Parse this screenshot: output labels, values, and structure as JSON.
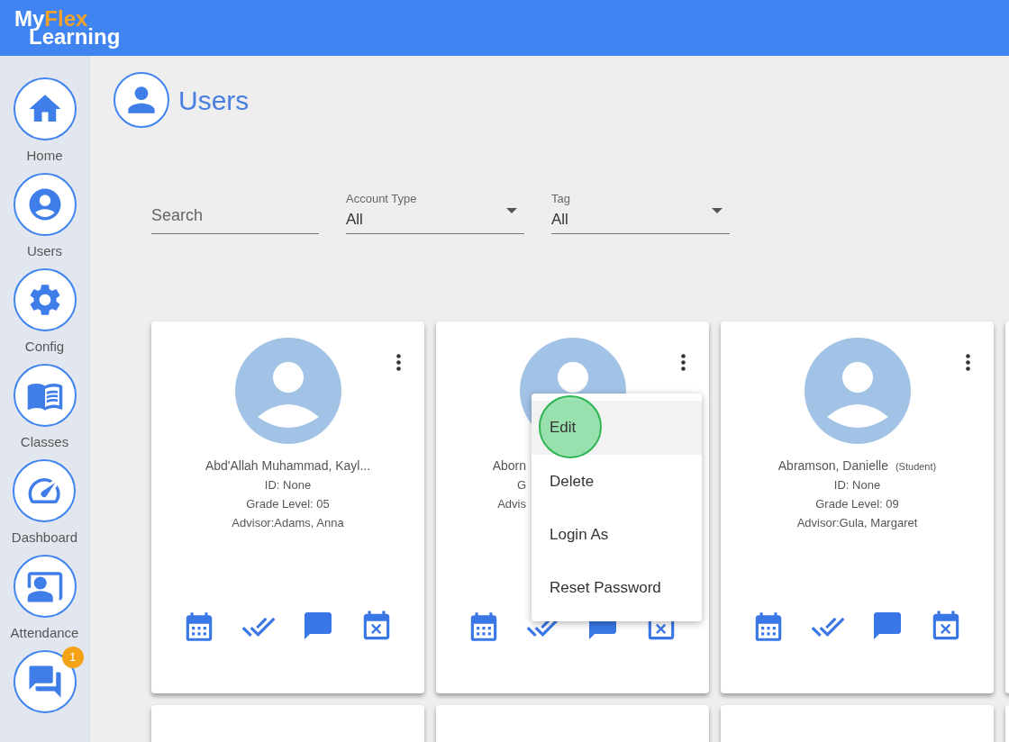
{
  "logo": {
    "top_plain": "My",
    "top_accent": "Flex",
    "bottom": "Learning"
  },
  "sidebar": {
    "items": [
      {
        "kind": "home",
        "label": "Home"
      },
      {
        "kind": "users",
        "label": "Users"
      },
      {
        "kind": "config",
        "label": "Config"
      },
      {
        "kind": "classes",
        "label": "Classes"
      },
      {
        "kind": "dashboard",
        "label": "Dashboard"
      },
      {
        "kind": "attendance",
        "label": "Attendance"
      },
      {
        "kind": "messages",
        "badge": "1"
      }
    ]
  },
  "page_title": "Users",
  "filters": {
    "search": {
      "placeholder": "Search"
    },
    "selects": [
      {
        "label": "Account Type",
        "value": "All"
      },
      {
        "label": "Tag",
        "value": "All"
      }
    ]
  },
  "cards": [
    {
      "name": "Abd'Allah Muhammad, Kayl...",
      "lines": [
        "ID: None",
        "Grade Level: 05",
        "Advisor:Adams, Anna"
      ],
      "menu_open": false
    },
    {
      "name": "Aborn",
      "lines": [
        "G",
        "Advis"
      ],
      "menu_open": true
    },
    {
      "name": "Abramson, Danielle",
      "role": "(Student)",
      "lines": [
        "ID: None",
        "Grade Level: 09",
        "Advisor:Gula, Margaret"
      ],
      "menu_open": false
    }
  ],
  "card_menu": {
    "items": [
      {
        "label": "Edit",
        "selected": true
      },
      {
        "label": "Delete",
        "selected": false
      },
      {
        "label": "Login As",
        "selected": false
      },
      {
        "label": "Reset Password",
        "selected": false
      }
    ]
  }
}
